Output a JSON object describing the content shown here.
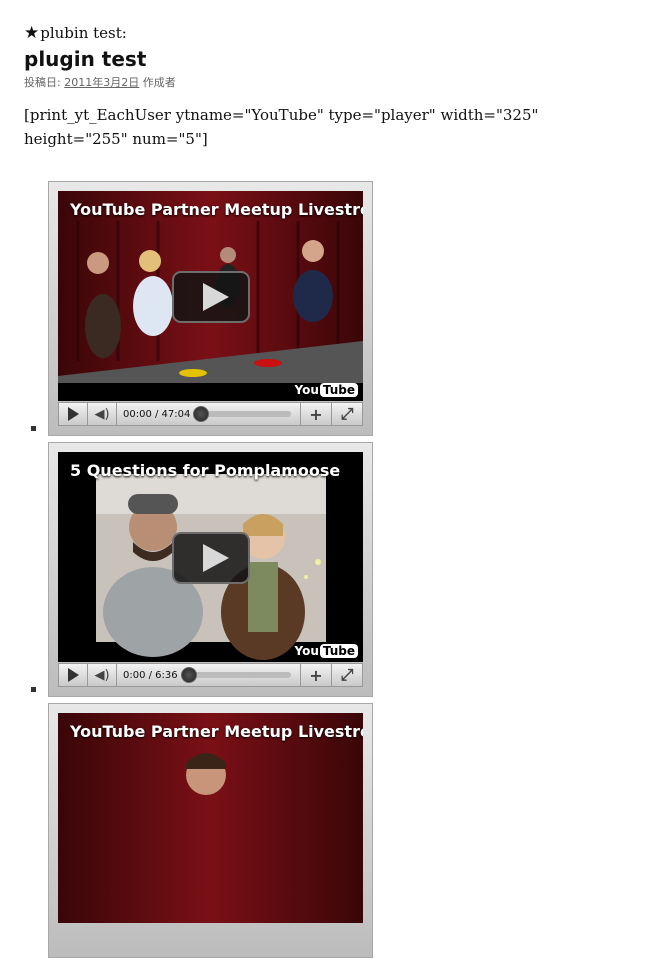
{
  "post": {
    "category_icon": "★",
    "category": "plubin test:",
    "title": "plugin test",
    "meta_label": "投稿日:",
    "date": "2011年3月2日",
    "author_label": "作成者",
    "shortcode": "[print_yt_EachUser ytname=\"YouTube\" type=\"player\" width=\"325\" height=\"255\" num=\"5\"]"
  },
  "videos": [
    {
      "title": "YouTube Partner Meetup Livestrea...",
      "time": "00:00 / 47:04",
      "progress": 0
    },
    {
      "title": "5 Questions for Pomplamoose",
      "time": "0:00 / 6:36",
      "progress": 0
    },
    {
      "title": "YouTube Partner Meetup Livestrea...",
      "time": "",
      "progress": 0
    }
  ],
  "player": {
    "logo_you": "You",
    "logo_tube": "Tube",
    "volume_icon": "speaker-icon",
    "add_icon": "plus-icon",
    "fullscreen_icon": "fullscreen-icon"
  }
}
